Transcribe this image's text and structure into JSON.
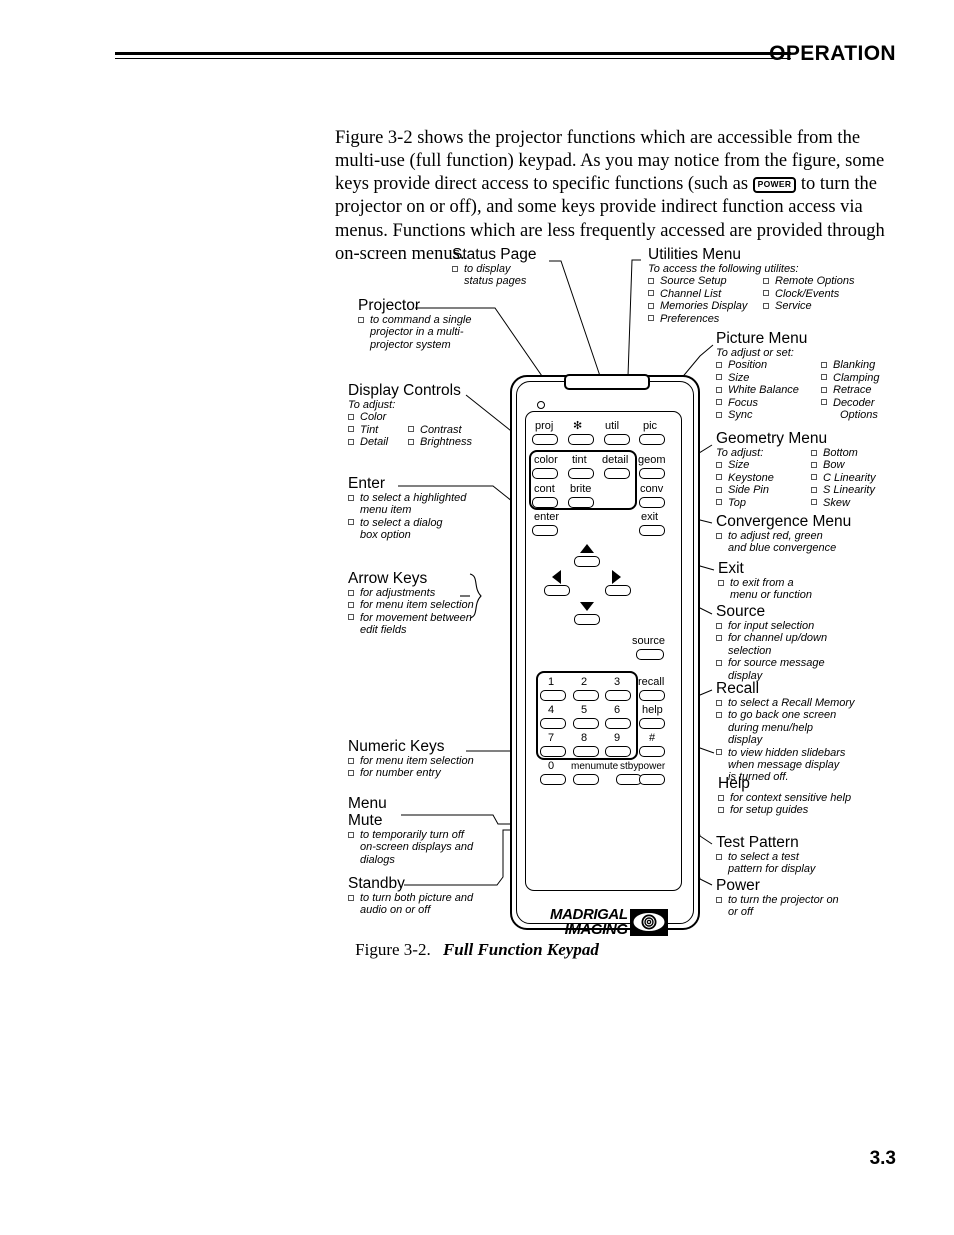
{
  "header": {
    "title": "OPERATION"
  },
  "page_number": "3.3",
  "intro": {
    "part1": "Figure 3-2 shows the projector functions which are accessible from the multi-use (full function) keypad. As you may notice from the figure, some keys provide direct access to specific functions (such as ",
    "power_key": "POWER",
    "part2": " to turn the projector on or off), and some keys provide indirect function access via menus. Functions which are less frequently accessed are provided through on-screen menus."
  },
  "caption": {
    "label": "Figure 3-2.",
    "title": "Full Function Keypad"
  },
  "callouts": {
    "status_page": {
      "title": "Status Page",
      "items": [
        "to display status pages"
      ]
    },
    "projector": {
      "title": "Projector",
      "items": [
        "to command a single projector in a multi-projector system"
      ]
    },
    "utilities_menu": {
      "title": "Utilities Menu",
      "subtitle": "To access the following utilites:",
      "col1": [
        "Source Setup",
        "Channel List",
        "Memories Display",
        "Preferences"
      ],
      "col2": [
        "Remote Options",
        "Clock/Events",
        "Service"
      ]
    },
    "picture_menu": {
      "title": "Picture Menu",
      "subtitle": "To adjust or set:",
      "col1": [
        "Position",
        "Size",
        "White Balance",
        "Focus",
        "Sync"
      ],
      "col2": [
        "Blanking",
        "Clamping",
        "Retrace",
        "Decoder"
      ],
      "col2_cont": "Options"
    },
    "geometry_menu": {
      "title": "Geometry Menu",
      "subtitle": "To adjust:",
      "col1": [
        "Size",
        "Keystone",
        "Side Pin",
        "Top"
      ],
      "col2": [
        "Bottom",
        "Bow",
        "C Linearity",
        "S Linearity",
        "Skew"
      ]
    },
    "convergence_menu": {
      "title": "Convergence Menu",
      "items": [
        "to adjust red, green and blue convergence"
      ]
    },
    "display_controls": {
      "title": "Display Controls",
      "subtitle": "To adjust:",
      "col1": [
        "Color",
        "Tint",
        "Detail"
      ],
      "col2": [
        "Contrast",
        "Brightness"
      ]
    },
    "enter": {
      "title": "Enter",
      "items": [
        "to select a highlighted menu item",
        "to select a dialog box option"
      ]
    },
    "arrow_keys": {
      "title": "Arrow Keys",
      "items": [
        "for adjustments",
        "for menu item selection",
        "for movement between edit fields"
      ]
    },
    "numeric_keys": {
      "title": "Numeric Keys",
      "items": [
        "for menu item selection",
        "for number entry"
      ]
    },
    "menu_mute": {
      "title_line1": "Menu",
      "title_line2": "Mute",
      "items": [
        "to temporarily turn off on-screen displays and dialogs"
      ]
    },
    "standby": {
      "title": "Standby",
      "items": [
        "to turn both picture and audio on or off"
      ]
    },
    "exit": {
      "title": "Exit",
      "items": [
        "to exit from a menu or function"
      ]
    },
    "source": {
      "title": "Source",
      "items": [
        "for input selection",
        "for channel up/down selection",
        "for source message display"
      ]
    },
    "recall": {
      "title": "Recall",
      "items": [
        "to select a Recall Memory",
        "to go back one screen during menu/help display",
        "to view hidden slidebars when message display is turned off."
      ]
    },
    "help": {
      "title": "Help",
      "items": [
        "for context sensitive help",
        "for setup guides"
      ]
    },
    "test_pattern": {
      "title": "Test Pattern",
      "items": [
        "to select a test pattern for display"
      ]
    },
    "power": {
      "title": "Power",
      "items": [
        "to turn the projector on or off"
      ]
    }
  },
  "keypad": {
    "row_top": [
      "proj",
      "✻",
      "util",
      "pic"
    ],
    "display_group": [
      "color",
      "tint",
      "detail",
      "cont",
      "brite"
    ],
    "right_col_upper": [
      "geom",
      "conv"
    ],
    "enter": "enter",
    "exit": "exit",
    "source": "source",
    "numbers": [
      "1",
      "2",
      "3",
      "4",
      "5",
      "6",
      "7",
      "8",
      "9",
      "0"
    ],
    "bottom_row": [
      "menu",
      "mute",
      "stby"
    ],
    "right_col_lower": [
      "recall",
      "help",
      "#",
      "power"
    ],
    "logo": {
      "line1": "MADRIGAL",
      "line2": "IMAGING"
    }
  }
}
